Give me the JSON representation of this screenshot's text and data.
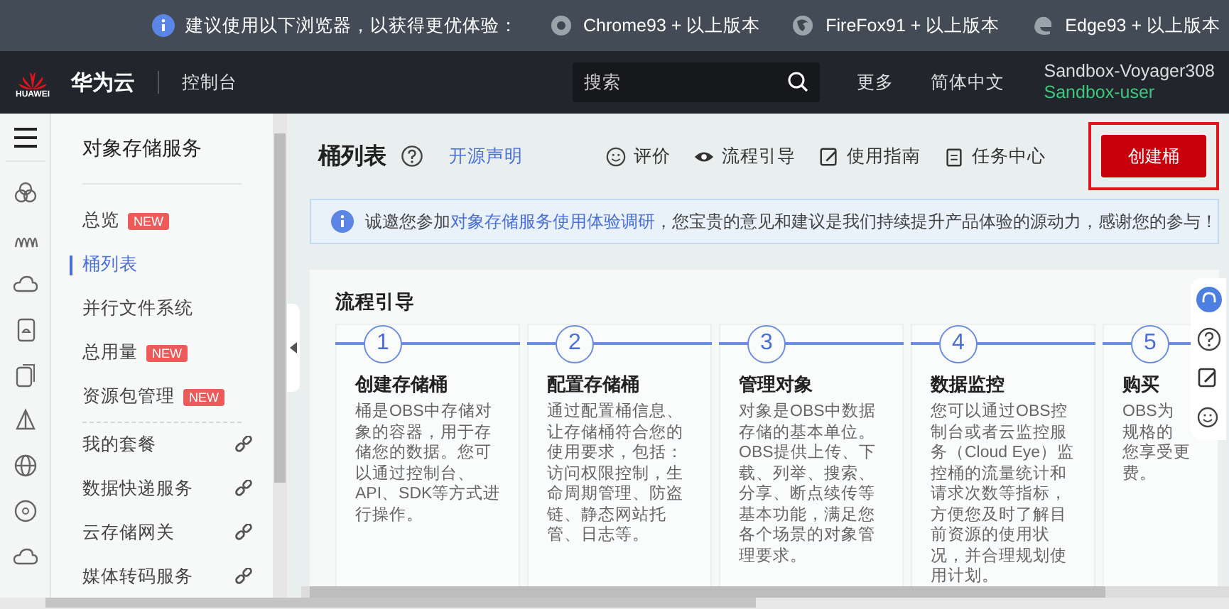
{
  "browser_notice": {
    "message": "建议使用以下浏览器，以获得更优体验：",
    "browsers": [
      {
        "kind": "chrome",
        "label": "Chrome93 + 以上版本"
      },
      {
        "kind": "firefox",
        "label": "FireFox91 + 以上版本"
      },
      {
        "kind": "edge",
        "label": "Edge93 + 以上版本"
      }
    ]
  },
  "header": {
    "logo_caption": "HUAWEI",
    "brand": "华为云",
    "console": "控制台",
    "search": {
      "placeholder": "搜索"
    },
    "links": [
      "更多",
      "简体中文"
    ],
    "user": {
      "name": "Sandbox-Voyager308",
      "role": "Sandbox-user"
    }
  },
  "service_rail": [
    {
      "kind": "circles"
    },
    {
      "kind": "waves"
    },
    {
      "kind": "cloud"
    },
    {
      "kind": "document"
    },
    {
      "kind": "documents"
    },
    {
      "kind": "sail"
    },
    {
      "kind": "globe"
    },
    {
      "kind": "circle"
    },
    {
      "kind": "cloud"
    }
  ],
  "sidebar": {
    "title": "对象存储服务",
    "items": [
      {
        "label": "总览",
        "badge": "NEW",
        "selected": false
      },
      {
        "label": "桶列表",
        "selected": true
      },
      {
        "label": "并行文件系统",
        "selected": false
      },
      {
        "label": "总用量",
        "badge": "NEW",
        "selected": false
      },
      {
        "label": "资源包管理",
        "badge": "NEW",
        "selected": false
      }
    ],
    "service_links": [
      "我的套餐",
      "数据快递服务",
      "云存储网关",
      "媒体转码服务"
    ]
  },
  "page": {
    "title": "桶列表",
    "license_link": "开源声明",
    "actions": [
      {
        "kind": "smile",
        "label": "评价"
      },
      {
        "kind": "eye",
        "label": "流程引导"
      },
      {
        "kind": "edit",
        "label": "使用指南"
      },
      {
        "kind": "clipboard",
        "label": "任务中心"
      }
    ],
    "create_button": {
      "label": "创建桶",
      "highlighted": true
    }
  },
  "survey": {
    "before": "诚邀您参加",
    "link": "对象存储服务使用体验调研",
    "after": "，您宝贵的意见和建议是我们持续提升产品体验的源动力，感谢您的参与！"
  },
  "guide": {
    "title": "流程引导",
    "steps": [
      {
        "number": "1",
        "title": "创建存储桶",
        "lines": [
          "桶是OBS中存储对",
          "象的容器，用于存",
          "储您的数据。您可",
          "以通过控制台、",
          "API、SDK等方式进",
          "行操作。"
        ]
      },
      {
        "number": "2",
        "title": "配置存储桶",
        "lines": [
          "通过配置桶信息、",
          "让存储桶符合您的",
          "使用要求，包括：",
          "访问权限控制，生",
          "命周期管理、防盗",
          "链、静态网站托",
          "管、日志等。"
        ]
      },
      {
        "number": "3",
        "title": "管理对象",
        "lines": [
          "对象是OBS中数据",
          "存储的基本单位。",
          "OBS提供上传、下",
          "载、列举、搜索、",
          "分享、断点续传等",
          "基本功能，满足您",
          "各个场景的对象管",
          "理要求。"
        ]
      },
      {
        "number": "4",
        "title": "数据监控",
        "lines": [
          "您可以通过OBS控",
          "制台或者云监控服",
          "务（Cloud Eye）监",
          "控桶的流量统计和",
          "请求次数等指标，",
          "方便您及时了解目",
          "前资源的使用状",
          "况，并合理规划使",
          "用计划。"
        ]
      },
      {
        "number": "5",
        "title": "购买",
        "lines": [
          "OBS为",
          "规格的",
          "您享受更",
          "费。"
        ]
      }
    ]
  },
  "float_tools": [
    {
      "kind": "headset"
    },
    {
      "kind": "help"
    },
    {
      "kind": "edit"
    },
    {
      "kind": "smile"
    }
  ]
}
